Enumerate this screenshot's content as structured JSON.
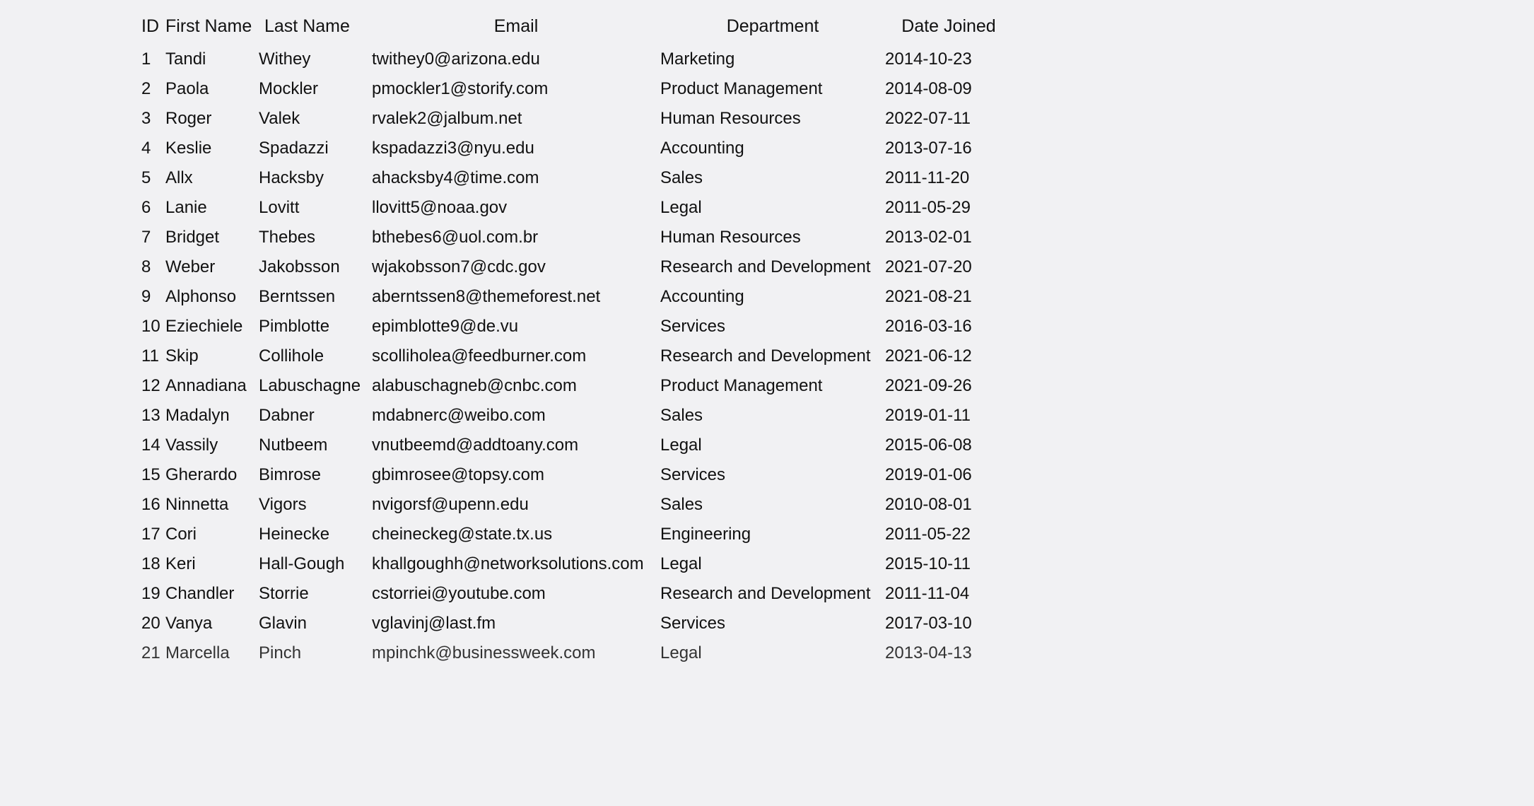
{
  "table": {
    "headers": {
      "id": "ID",
      "first": "First Name",
      "last": "Last Name",
      "email": "Email",
      "dept": "Department",
      "date": "Date Joined"
    },
    "rows": [
      {
        "id": "1",
        "first": "Tandi",
        "last": "Withey",
        "email": "twithey0@arizona.edu",
        "dept": "Marketing",
        "date": "2014-10-23"
      },
      {
        "id": "2",
        "first": "Paola",
        "last": "Mockler",
        "email": "pmockler1@storify.com",
        "dept": "Product Management",
        "date": "2014-08-09"
      },
      {
        "id": "3",
        "first": "Roger",
        "last": "Valek",
        "email": "rvalek2@jalbum.net",
        "dept": "Human Resources",
        "date": "2022-07-11"
      },
      {
        "id": "4",
        "first": "Keslie",
        "last": "Spadazzi",
        "email": "kspadazzi3@nyu.edu",
        "dept": "Accounting",
        "date": "2013-07-16"
      },
      {
        "id": "5",
        "first": "Allx",
        "last": "Hacksby",
        "email": "ahacksby4@time.com",
        "dept": "Sales",
        "date": "2011-11-20"
      },
      {
        "id": "6",
        "first": "Lanie",
        "last": "Lovitt",
        "email": "llovitt5@noaa.gov",
        "dept": "Legal",
        "date": "2011-05-29"
      },
      {
        "id": "7",
        "first": "Bridget",
        "last": "Thebes",
        "email": "bthebes6@uol.com.br",
        "dept": "Human Resources",
        "date": "2013-02-01"
      },
      {
        "id": "8",
        "first": "Weber",
        "last": "Jakobsson",
        "email": "wjakobsson7@cdc.gov",
        "dept": "Research and Development",
        "date": "2021-07-20"
      },
      {
        "id": "9",
        "first": "Alphonso",
        "last": "Berntssen",
        "email": "aberntssen8@themeforest.net",
        "dept": "Accounting",
        "date": "2021-08-21"
      },
      {
        "id": "10",
        "first": "Eziechiele",
        "last": "Pimblotte",
        "email": "epimblotte9@de.vu",
        "dept": "Services",
        "date": "2016-03-16"
      },
      {
        "id": "11",
        "first": "Skip",
        "last": "Collihole",
        "email": "scolliholea@feedburner.com",
        "dept": "Research and Development",
        "date": "2021-06-12"
      },
      {
        "id": "12",
        "first": "Annadiana",
        "last": "Labuschagne",
        "email": "alabuschagneb@cnbc.com",
        "dept": "Product Management",
        "date": "2021-09-26"
      },
      {
        "id": "13",
        "first": "Madalyn",
        "last": "Dabner",
        "email": "mdabnerc@weibo.com",
        "dept": "Sales",
        "date": "2019-01-11"
      },
      {
        "id": "14",
        "first": "Vassily",
        "last": "Nutbeem",
        "email": "vnutbeemd@addtoany.com",
        "dept": "Legal",
        "date": "2015-06-08"
      },
      {
        "id": "15",
        "first": "Gherardo",
        "last": "Bimrose",
        "email": "gbimrosee@topsy.com",
        "dept": "Services",
        "date": "2019-01-06"
      },
      {
        "id": "16",
        "first": "Ninnetta",
        "last": "Vigors",
        "email": "nvigorsf@upenn.edu",
        "dept": "Sales",
        "date": "2010-08-01"
      },
      {
        "id": "17",
        "first": "Cori",
        "last": "Heinecke",
        "email": "cheineckeg@state.tx.us",
        "dept": "Engineering",
        "date": "2011-05-22"
      },
      {
        "id": "18",
        "first": "Keri",
        "last": "Hall-Gough",
        "email": "khallgoughh@networksolutions.com",
        "dept": "Legal",
        "date": "2015-10-11"
      },
      {
        "id": "19",
        "first": "Chandler",
        "last": "Storrie",
        "email": "cstorriei@youtube.com",
        "dept": "Research and Development",
        "date": "2011-11-04"
      },
      {
        "id": "20",
        "first": "Vanya",
        "last": "Glavin",
        "email": "vglavinj@last.fm",
        "dept": "Services",
        "date": "2017-03-10"
      },
      {
        "id": "21",
        "first": "Marcella",
        "last": "Pinch",
        "email": "mpinchk@businessweek.com",
        "dept": "Legal",
        "date": "2013-04-13"
      }
    ]
  }
}
